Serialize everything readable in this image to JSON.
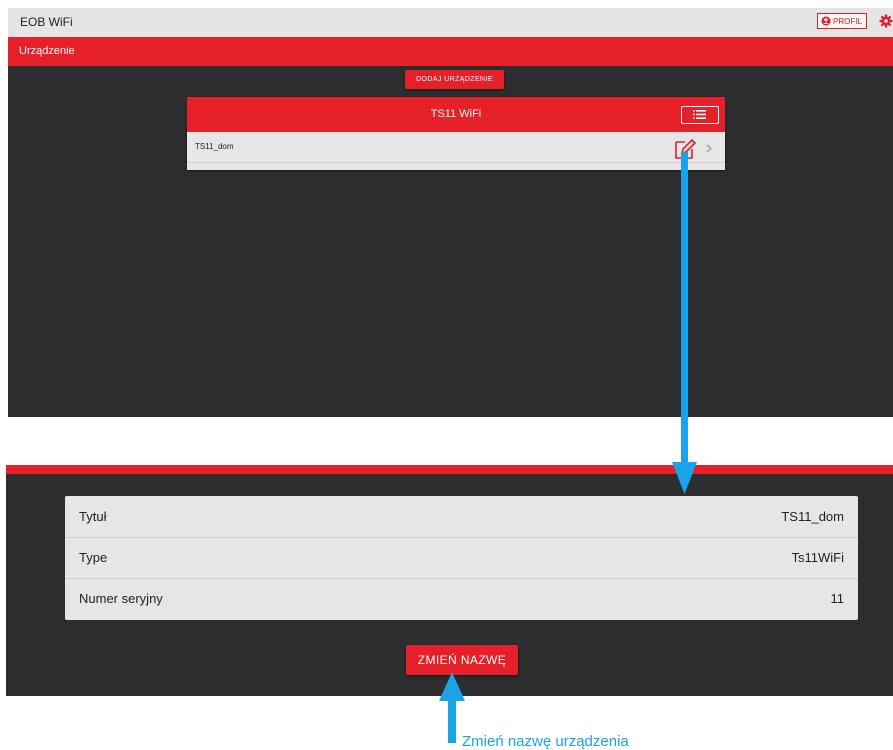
{
  "top_screen": {
    "app_title": "EOB WiFi",
    "profile_label": "PROFIL",
    "section_title": "Urządzenie",
    "add_device_label": "DODAJ URZĄDZENIE",
    "card": {
      "title": "TS11 WiFi",
      "device_name": "TS11_dom"
    }
  },
  "bottom_screen": {
    "details": [
      {
        "label": "Tytuł",
        "value": "TS11_dom"
      },
      {
        "label": "Type",
        "value": "Ts11WiFi"
      },
      {
        "label": "Numer seryjny",
        "value": "11"
      }
    ],
    "rename_label": "ZMIEŃ NAZWĘ"
  },
  "annotation": {
    "label": "Zmień nazwę urządzenia"
  },
  "colors": {
    "accent_red": "#e62028",
    "background_dark": "#2b2d2f",
    "card_gray": "#e6e6e6",
    "annotation_blue": "#1aa3e8"
  }
}
